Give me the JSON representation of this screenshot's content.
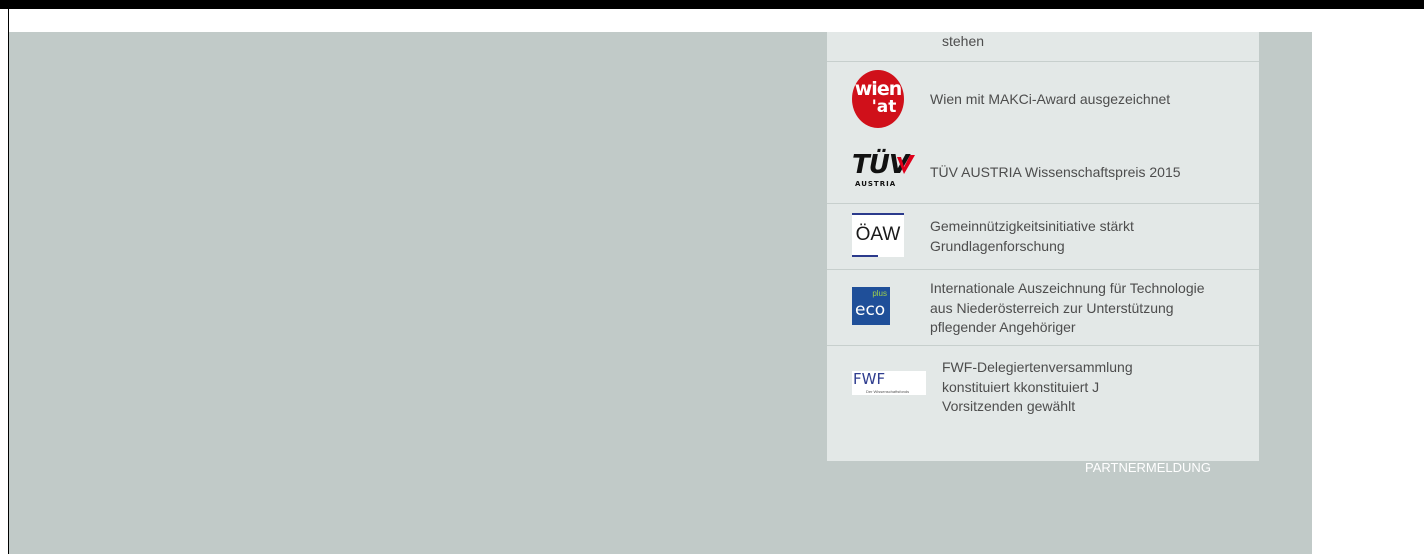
{
  "news_panel": {
    "top_fragment": "stehen",
    "items": [
      {
        "logo": {
          "name": "wien-at-logo",
          "line1": "wien",
          "line2": "'at"
        },
        "title": "Wien mit MAKCi-Award ausgezeichnet"
      },
      {
        "logo": {
          "name": "tuv-austria-logo",
          "line1": "TÜV",
          "line2": "AUSTRIA"
        },
        "title": "TÜV AUSTRIA Wissenschaftspreis 2015"
      },
      {
        "logo": {
          "name": "oeaw-logo",
          "text": "ÖAW"
        },
        "title": "Gemeinnützigkeitsinitiative stärkt Grundlagenforschung"
      },
      {
        "logo": {
          "name": "ecoplus-logo",
          "super": "plus",
          "text": "eco"
        },
        "title": "Internationale Auszeichnung für Technologie aus Niederösterreich zur Unterstützung pflegender Angehöriger"
      },
      {
        "logo": {
          "name": "fwf-logo",
          "text": "FWF",
          "tagline": "Der Wissenschaftsfonds"
        },
        "title": "FWF-Delegiertenversammlung konstituiert kkonstituiert J Vorsitzenden gewählt"
      }
    ]
  },
  "partner_label": "PARTNERMELDUNG",
  "colors": {
    "stage_background": "#c1cac8",
    "panel_background": "#e3e8e7",
    "text": "#4d4d4d",
    "wien_red": "#d0101a",
    "oeaw_blue": "#2b3a8c",
    "ecoplus_blue": "#1f4f99",
    "fwf_blue": "#2f3d8f"
  }
}
